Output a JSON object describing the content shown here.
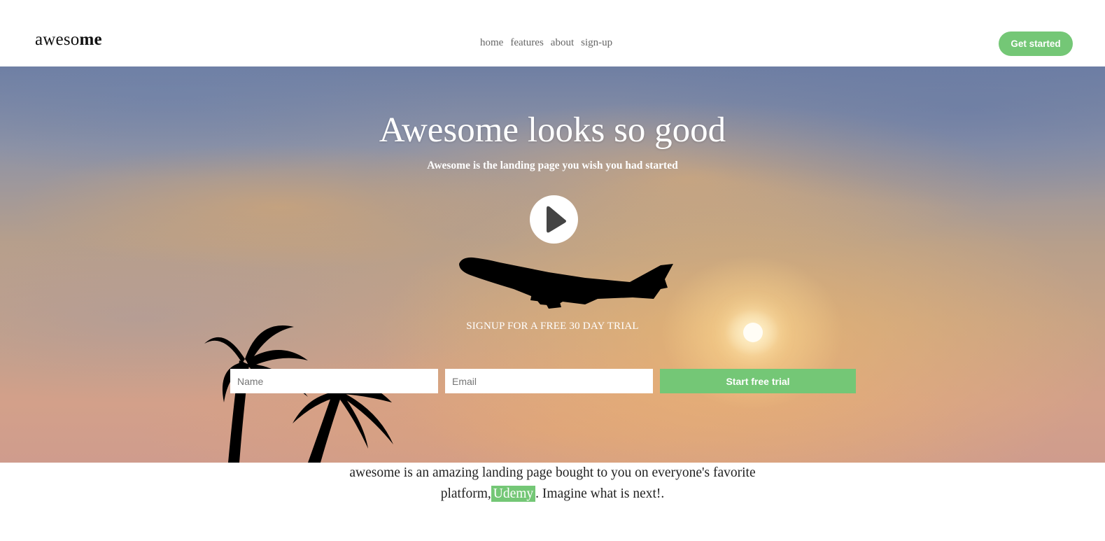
{
  "header": {
    "logo_light": "aweso",
    "logo_bold": "me",
    "nav": [
      "home",
      "features",
      "about",
      "sign-up"
    ],
    "cta_label": "Get started"
  },
  "hero": {
    "title": "Awesome looks so good",
    "subtitle": "Awesome is the landing page you wish you had started",
    "signup_label": "SIGNUP FOR A FREE 30 DAY TRIAL",
    "name_placeholder": "Name",
    "email_placeholder": "Email",
    "trial_button_label": "Start free trial",
    "play_icon": "play-icon"
  },
  "about": {
    "line1": "awesome is an amazing landing page bought to you on everyone's favorite",
    "line2_before": "platform,",
    "line2_highlight": "Udemy",
    "line2_after": ". Imagine what is next!."
  },
  "colors": {
    "accent": "#74c776",
    "text": "#222222",
    "nav_text": "#666666"
  }
}
